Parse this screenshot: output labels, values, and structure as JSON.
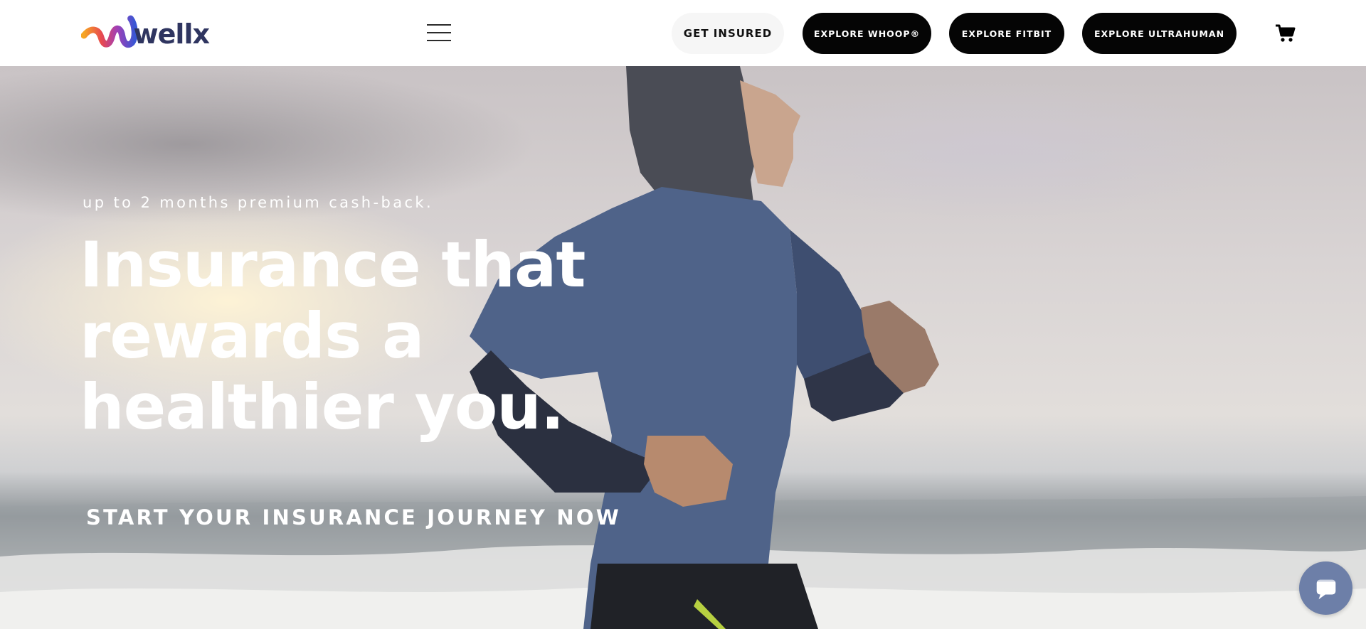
{
  "header": {
    "logo_text": "wellx",
    "menu_icon": "hamburger-menu-icon",
    "buttons": {
      "get_insured": "GET INSURED",
      "explore_whoop": "EXPLORE WHOOP®",
      "explore_fitbit": "EXPLORE FITBIT",
      "explore_ultrahuman": "EXPLORE ULTRAHUMAN"
    },
    "cart_icon": "shopping-cart-icon"
  },
  "hero": {
    "tagline": "up to 2 months premium cash-back.",
    "heading_lines": [
      "Insurance that",
      "rewards a",
      "healthier you."
    ],
    "cta": "START YOUR INSURANCE JOURNEY NOW"
  },
  "chat": {
    "icon": "chat-bubble-icon"
  },
  "colors": {
    "brand_navy": "#2f3560",
    "button_dark": "#050505",
    "button_light": "#f6f6f6",
    "chat_bubble": "#6d7fa8"
  }
}
